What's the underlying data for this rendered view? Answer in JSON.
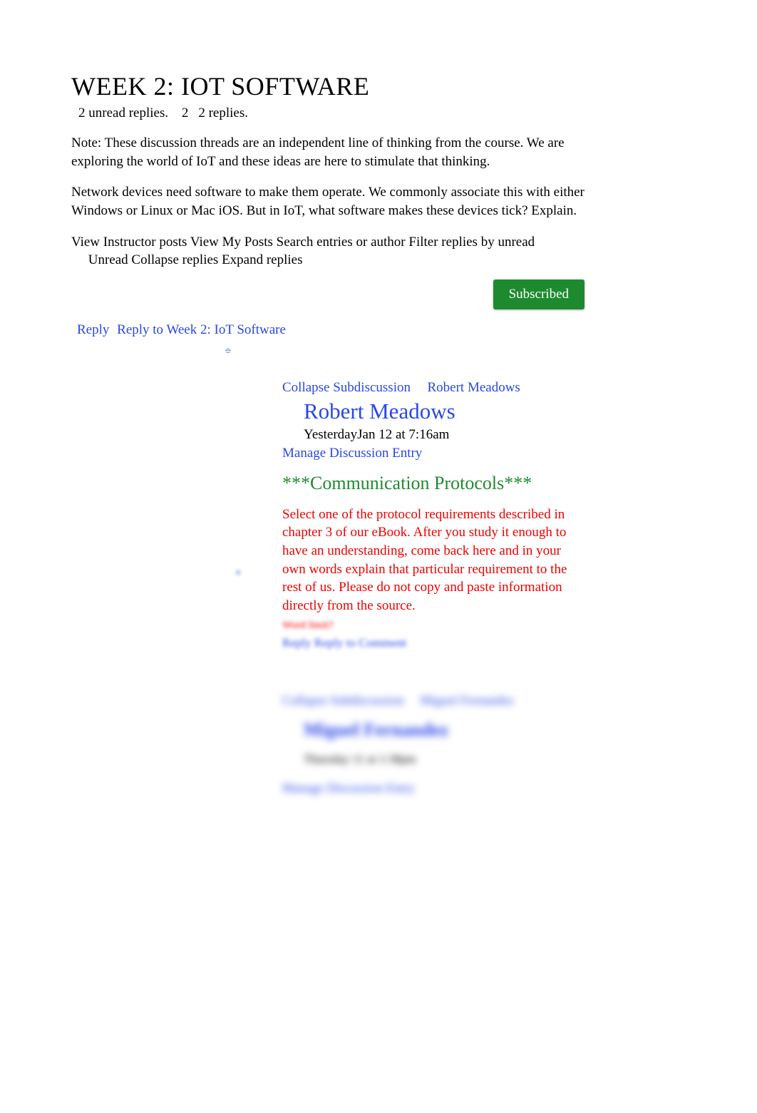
{
  "header": {
    "title": "WEEK 2: IOT SOFTWARE",
    "unread_replies": "2 unread replies.",
    "replies_count_prefix": "2",
    "replies_count": "2 replies."
  },
  "note": "Note: These discussion threads are an independent line of thinking from the course. We are exploring the world of IoT and these ideas are here to stimulate that thinking.",
  "prompt": "Network devices need software to make them operate. We commonly associate this with either Windows or Linux or Mac iOS. But in IoT, what software makes these devices tick? Explain.",
  "toolbar": {
    "view_instructor": "View Instructor posts",
    "view_my_posts": "View My Posts",
    "search": "Search entries or author",
    "filter_unread": "Filter replies by unread",
    "unread": "Unread",
    "collapse": "Collapse replies",
    "expand": "Expand replies",
    "subscribed": "Subscribed"
  },
  "reply": {
    "reply": "Reply",
    "reply_to": "Reply to Week 2: IoT Software"
  },
  "posts": [
    {
      "collapse": "Collapse Subdiscussion",
      "author_link": "Robert Meadows",
      "author": "Robert Meadows",
      "time_prefix": "Yesterday",
      "time": "Jan 12 at 7:16am",
      "manage": "Manage Discussion Entry",
      "title": "***Communication Protocols***",
      "body": "Select one of the protocol requirements described in chapter 3 of our eBook. After you study it enough to have an understanding, come back here and in your own words explain that particular requirement to the rest of us. Please do not copy and paste information directly from the source.",
      "word_limit": "Word limit?",
      "reply": "Reply",
      "reply_to": "Reply to Comment"
    },
    {
      "collapse": "Collapse Subdiscussion",
      "author_link": "Miguel Fernandez",
      "author": "Miguel Fernandez",
      "time_prefix": "Thursday",
      "time": "11 at 1:38pm",
      "manage": "Manage Discussion Entry"
    }
  ]
}
